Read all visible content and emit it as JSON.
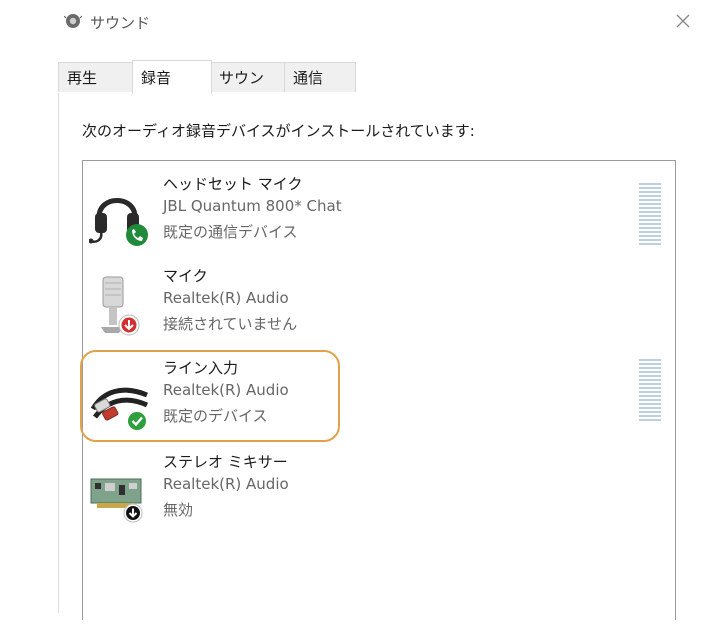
{
  "window": {
    "title": "サウンド"
  },
  "tabs": [
    {
      "label": "再生"
    },
    {
      "label": "録音"
    },
    {
      "label": "サウンド"
    },
    {
      "label": "通信"
    }
  ],
  "description": "次のオーディオ録音デバイスがインストールされています:",
  "devices": [
    {
      "name": "ヘッドセット マイク",
      "subtitle": "JBL Quantum 800* Chat",
      "status": "既定の通信デバイス",
      "icon": "headset-icon",
      "badge": "phone-badge"
    },
    {
      "name": "マイク",
      "subtitle": "Realtek(R) Audio",
      "status": "接続されていません",
      "icon": "microphone-icon",
      "badge": "down-arrow-badge"
    },
    {
      "name": "ライン入力",
      "subtitle": "Realtek(R) Audio",
      "status": "既定のデバイス",
      "icon": "line-in-cable-icon",
      "badge": "check-badge"
    },
    {
      "name": "ステレオ ミキサー",
      "subtitle": "Realtek(R) Audio",
      "status": "無効",
      "icon": "sound-card-icon",
      "badge": "down-arrow-badge"
    }
  ],
  "colors": {
    "accent_highlight": "#e2a24c",
    "level_meter": "#bcd0e0",
    "check_green": "#2e9e3e",
    "phone_green": "#1f8a3a",
    "arrow_red": "#d32f2f"
  }
}
